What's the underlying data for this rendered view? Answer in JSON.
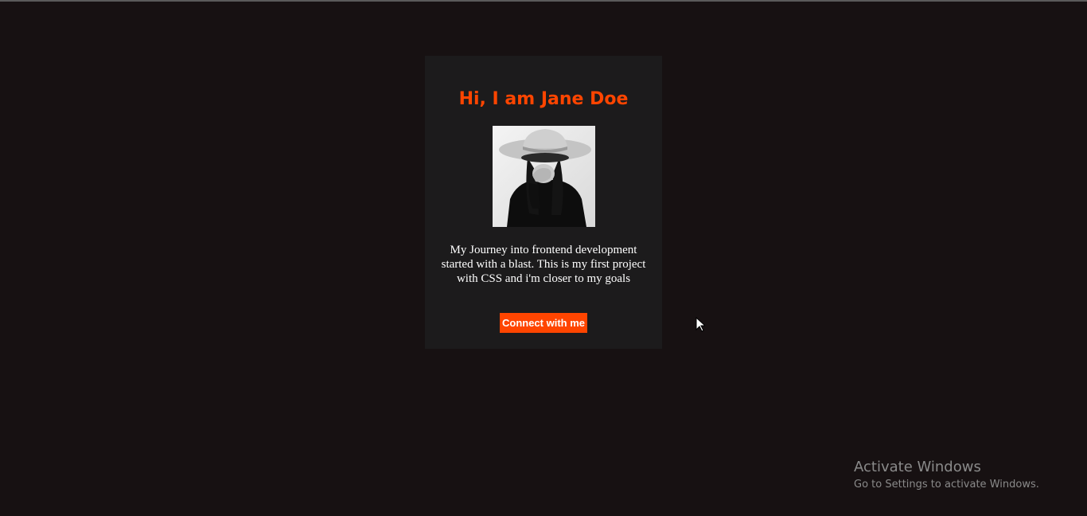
{
  "page": {
    "background_color": "#171112",
    "card_color": "#1c1b1c",
    "accent_color": "#ff4500"
  },
  "profile": {
    "heading": "Hi, I am Jane Doe",
    "photo_description_icon": "profile-photo-woman-in-hat",
    "bio": "My Journey into frontend development started with a blast. This is my first project with CSS and i'm closer to my goals",
    "connect_button_label": "Connect with me"
  },
  "os_overlay": {
    "watermark_title": "Activate Windows",
    "watermark_subtitle": "Go to Settings to activate Windows."
  }
}
